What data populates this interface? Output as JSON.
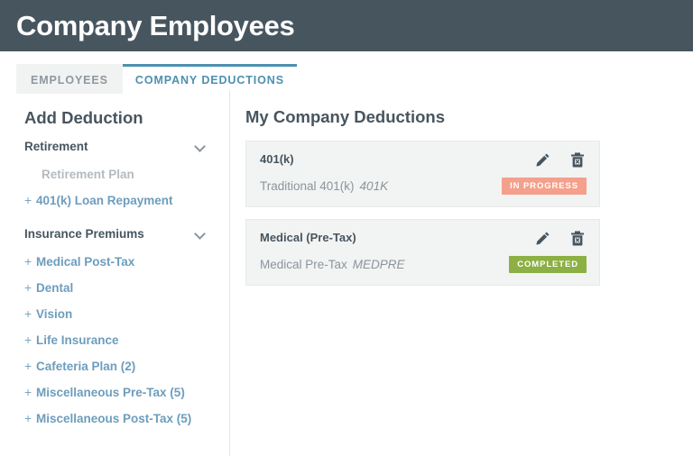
{
  "header": {
    "title": "Company Employees",
    "background_color": "#47555f"
  },
  "tabs": [
    {
      "label": "EMPLOYEES",
      "active": false
    },
    {
      "label": "COMPANY DEDUCTIONS",
      "active": true
    }
  ],
  "sidebar": {
    "title": "Add Deduction",
    "groups": [
      {
        "label": "Retirement",
        "expanded": true,
        "items": [
          {
            "label": "Retirement Plan",
            "disabled": true
          },
          {
            "label": "401(k) Loan Repayment",
            "disabled": false
          }
        ]
      },
      {
        "label": "Insurance Premiums",
        "expanded": true,
        "items": [
          {
            "label": "Medical Post-Tax",
            "disabled": false
          },
          {
            "label": "Dental",
            "disabled": false
          },
          {
            "label": "Vision",
            "disabled": false
          },
          {
            "label": "Life Insurance",
            "disabled": false
          },
          {
            "label": "Cafeteria Plan (2)",
            "disabled": false
          },
          {
            "label": "Miscellaneous Pre-Tax (5)",
            "disabled": false
          },
          {
            "label": "Miscellaneous Post-Tax (5)",
            "disabled": false
          }
        ]
      }
    ]
  },
  "main": {
    "title": "My Company Deductions",
    "cards": [
      {
        "name": "401(k)",
        "description": "Traditional 401(k)",
        "code": "401K",
        "status": "IN PROGRESS",
        "status_color": "#f4a08c",
        "edit_label": "Edit",
        "delete_label": "Delete"
      },
      {
        "name": "Medical (Pre-Tax)",
        "description": "Medical Pre-Tax",
        "code": "MEDPRE",
        "status": "COMPLETED",
        "status_color": "#8cb043",
        "edit_label": "Edit",
        "delete_label": "Delete"
      }
    ]
  },
  "colors": {
    "accent_blue": "#4d90b0",
    "link_blue": "#6d9dbd",
    "text_dark": "#47555f",
    "text_muted": "#8b959c"
  },
  "icons": {
    "chevron": "chevron-down-icon",
    "plus": "+",
    "edit": "pencil-icon",
    "delete": "trash-icon"
  }
}
